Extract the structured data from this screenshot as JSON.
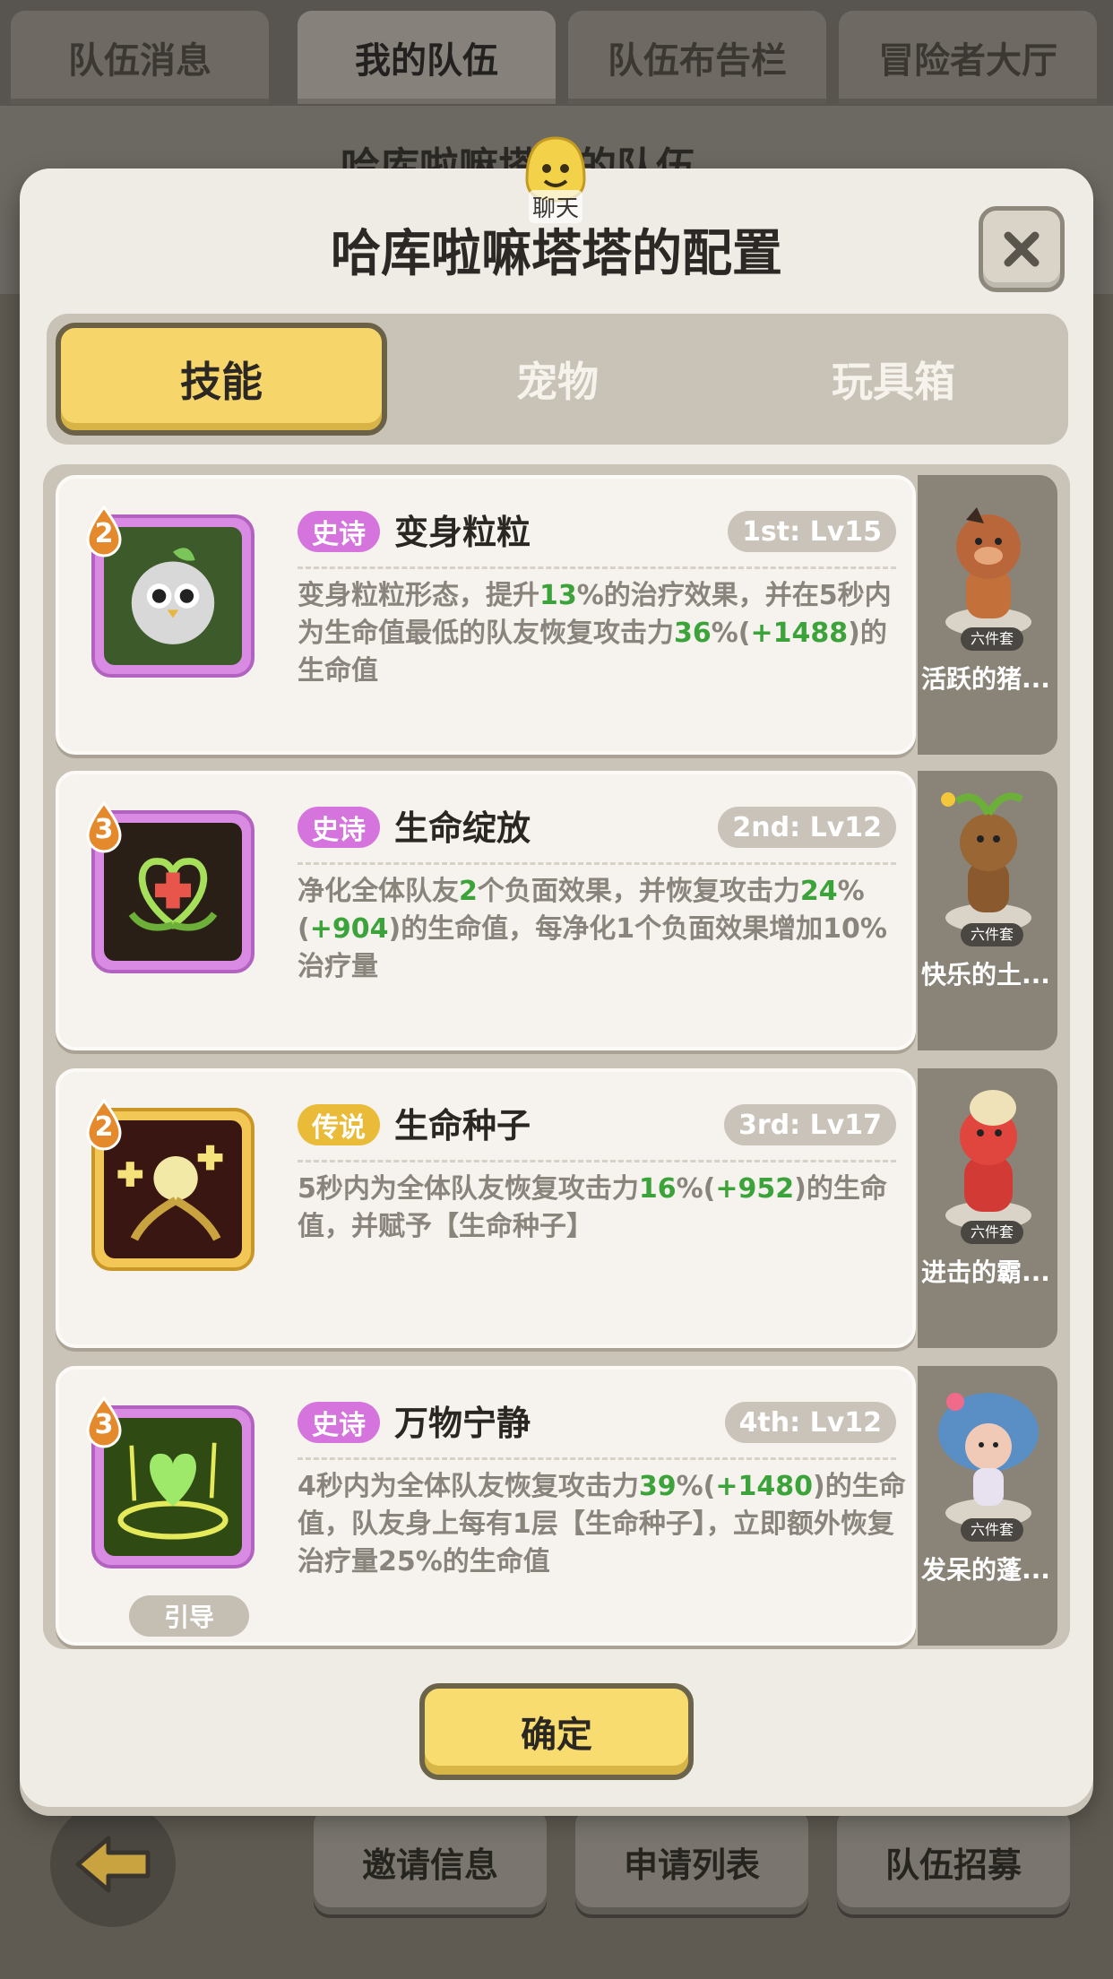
{
  "top_tabs": [
    "队伍消息",
    "我的队伍",
    "队伍布告栏",
    "冒险者大厅"
  ],
  "background": {
    "team_title": "哈库啦嘛塔塔的队伍"
  },
  "modal": {
    "title": "哈库啦嘛塔塔的配置",
    "chat_label": "聊天",
    "tabs": [
      "技能",
      "宠物",
      "玩具箱"
    ],
    "active_tab": "技能",
    "confirm_label": "确定"
  },
  "skills": [
    {
      "level": "2",
      "rarity": "史诗",
      "name": "变身粒粒",
      "rank": "1st: Lv15",
      "desc": [
        {
          "t": "变身粒粒形态，提升"
        },
        {
          "t": "13",
          "hl": true
        },
        {
          "t": "%的治疗效果，并在5秒内为生命值最低的队友恢复攻击力"
        },
        {
          "t": "36",
          "hl": true
        },
        {
          "t": "%("
        },
        {
          "t": "+1488",
          "hl": true
        },
        {
          "t": ")的生命值"
        }
      ],
      "pet_name": "活跃的猪...",
      "pet_badge": "六件套"
    },
    {
      "level": "3",
      "rarity": "史诗",
      "name": "生命绽放",
      "rank": "2nd: Lv12",
      "desc": [
        {
          "t": "净化全体队友"
        },
        {
          "t": "2",
          "hl": true
        },
        {
          "t": "个负面效果，并恢复攻击力"
        },
        {
          "t": "24",
          "hl": true
        },
        {
          "t": "%("
        },
        {
          "t": "+904",
          "hl": true
        },
        {
          "t": ")的生命值，每净化1个负面效果增加10%治疗量"
        }
      ],
      "pet_name": "快乐的土...",
      "pet_badge": "六件套"
    },
    {
      "level": "2",
      "rarity": "传说",
      "name": "生命种子",
      "rank": "3rd: Lv17",
      "desc": [
        {
          "t": "5秒内为全体队友恢复攻击力"
        },
        {
          "t": "16",
          "hl": true
        },
        {
          "t": "%("
        },
        {
          "t": "+952",
          "hl": true
        },
        {
          "t": ")的生命值，并赋予【生命种子】"
        }
      ],
      "pet_name": "进击的霸...",
      "pet_badge": "六件套"
    },
    {
      "level": "3",
      "rarity": "史诗",
      "name": "万物宁静",
      "rank": "4th: Lv12",
      "guide": "引导",
      "desc": [
        {
          "t": "4秒内为全体队友恢复攻击力"
        },
        {
          "t": "39",
          "hl": true
        },
        {
          "t": "%("
        },
        {
          "t": "+1480",
          "hl": true
        },
        {
          "t": ")的生命值，队友身上每有1层【生命种子】，立即额外恢复治疗量25%的生命值"
        }
      ],
      "pet_name": "发呆的蓬...",
      "pet_badge": "六件套"
    }
  ],
  "bottom_buttons": [
    "邀请信息",
    "申请列表",
    "队伍招募"
  ],
  "colors": {
    "epic": "#d574dd",
    "legend": "#e9bb39",
    "highlight_number": "#3ba33a",
    "confirm_yellow": "#f8dc6f"
  }
}
